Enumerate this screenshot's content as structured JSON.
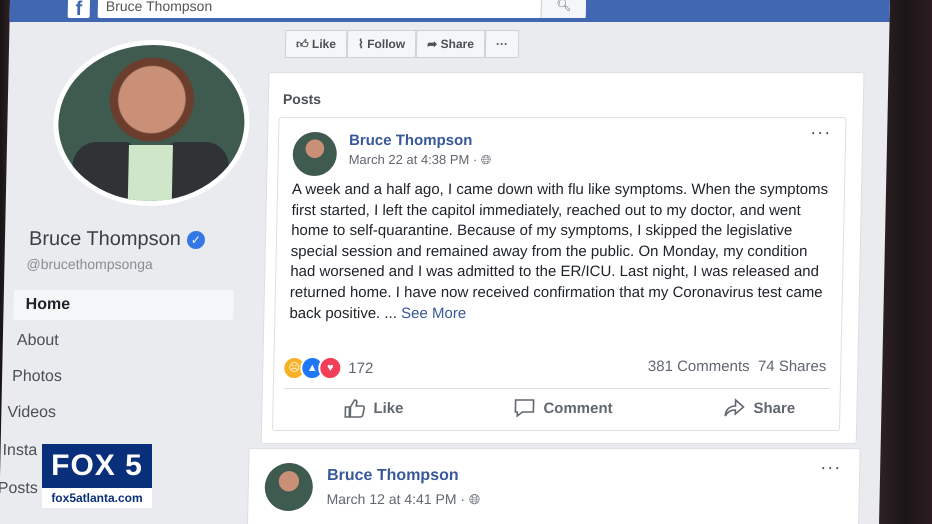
{
  "search": {
    "value": "Bruce Thompson"
  },
  "fb_logo": "f",
  "profile": {
    "name": "Bruce Thompson",
    "handle": "@brucethompsonga"
  },
  "nav": {
    "home": "Home",
    "about": "About",
    "photos": "Photos",
    "videos": "Videos",
    "instagram_partial": "Insta",
    "posts_partial": "Posts"
  },
  "actions": {
    "like": "Like",
    "follow": "Follow",
    "share": "Share",
    "more": "···"
  },
  "posts_section": {
    "title": "Posts"
  },
  "post1": {
    "author": "Bruce Thompson",
    "date": "March 22 at 4:38 PM · ",
    "text": "A week and a half ago, I came down with flu like symptoms. When the symptoms first started, I left the capitol immediately, reached out to my doctor, and went home to self-quarantine. Because of my symptoms, I skipped the legislative special session and remained away from the public. On Monday, my condition had worsened and I was admitted to the ER/ICU. Last night, I was released and returned home. I have now received confirmation that my Coronavirus test came back positive. ... ",
    "see_more": "See More",
    "reaction_count": "172",
    "comments": "381 Comments",
    "shares": "74 Shares",
    "like_btn": "Like",
    "comment_btn": "Comment",
    "share_btn": "Share",
    "menu": "···"
  },
  "post2": {
    "author": "Bruce Thompson",
    "date": "March 12 at 4:41 PM · ",
    "menu": "···"
  },
  "broadcast_logo": {
    "top": "FOX 5",
    "bottom": "fox5atlanta.com"
  },
  "colors": {
    "facebook_blue": "#4267b2",
    "link_blue": "#385898",
    "verified_blue": "#3578e5",
    "fox_navy": "#0a2f7a"
  }
}
